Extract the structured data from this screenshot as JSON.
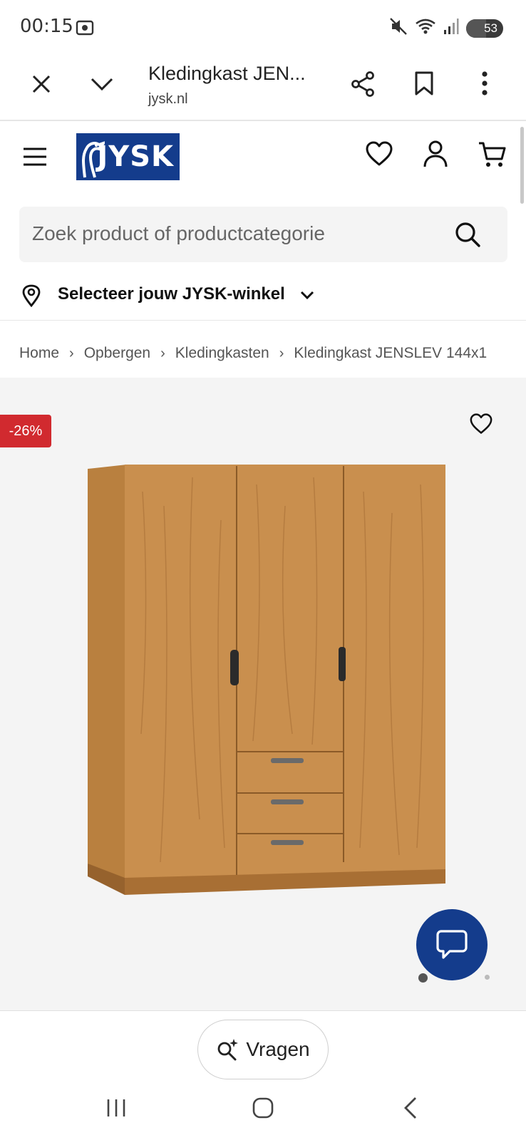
{
  "status_bar": {
    "time": "00:15",
    "battery": "53"
  },
  "tab_header": {
    "title": "Kledingkast JEN...",
    "url": "jysk.nl"
  },
  "site": {
    "logo_text": "JYSK",
    "search_placeholder": "Zoek product of productcategorie",
    "store_selector": "Selecteer jouw JYSK-winkel"
  },
  "breadcrumb": [
    "Home",
    "Opbergen",
    "Kledingkasten",
    "Kledingkast JENSLEV 144x1"
  ],
  "product": {
    "discount": "-26%"
  },
  "ask": {
    "label": "Vragen"
  },
  "colors": {
    "brand_blue": "#143c8c",
    "discount_red": "#d12a2f",
    "wood": "#c98f4e"
  }
}
